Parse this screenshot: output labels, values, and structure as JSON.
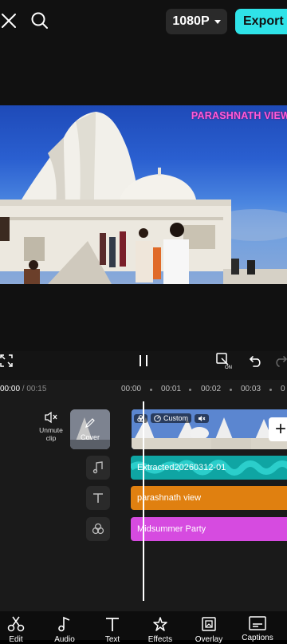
{
  "topbar": {
    "close_icon": "close-icon",
    "search_icon": "search-icon",
    "resolution": "1080P",
    "export_label": "Export"
  },
  "preview": {
    "overlay_text": "PARASHNATH VIEW"
  },
  "timeline": {
    "current_time": "00:00",
    "total_time": " / 00:15",
    "ruler": [
      "00:00",
      "00:01",
      "00:02",
      "00:03",
      "0"
    ],
    "unmute_label": "Unmute\nclip",
    "cover_label": "Cover",
    "custom_tag": "Custom",
    "audio_track": "Extracted20260312-01",
    "text_track": "parashnath view",
    "effect_track": "Midsummer Party"
  },
  "toolbar": {
    "items": [
      {
        "label": "Edit",
        "icon": "scissors-icon"
      },
      {
        "label": "Audio",
        "icon": "music-note-icon"
      },
      {
        "label": "Text",
        "icon": "text-icon"
      },
      {
        "label": "Effects",
        "icon": "effects-icon"
      },
      {
        "label": "Overlay",
        "icon": "overlay-icon"
      },
      {
        "label": "Captions",
        "icon": "captions-icon"
      }
    ]
  },
  "colors": {
    "accent": "#2fe3e8",
    "audio_track": "#0fa5a3",
    "text_track": "#e08010",
    "effect_track": "#d64be0",
    "overlay_text": "#ff5bd8"
  }
}
